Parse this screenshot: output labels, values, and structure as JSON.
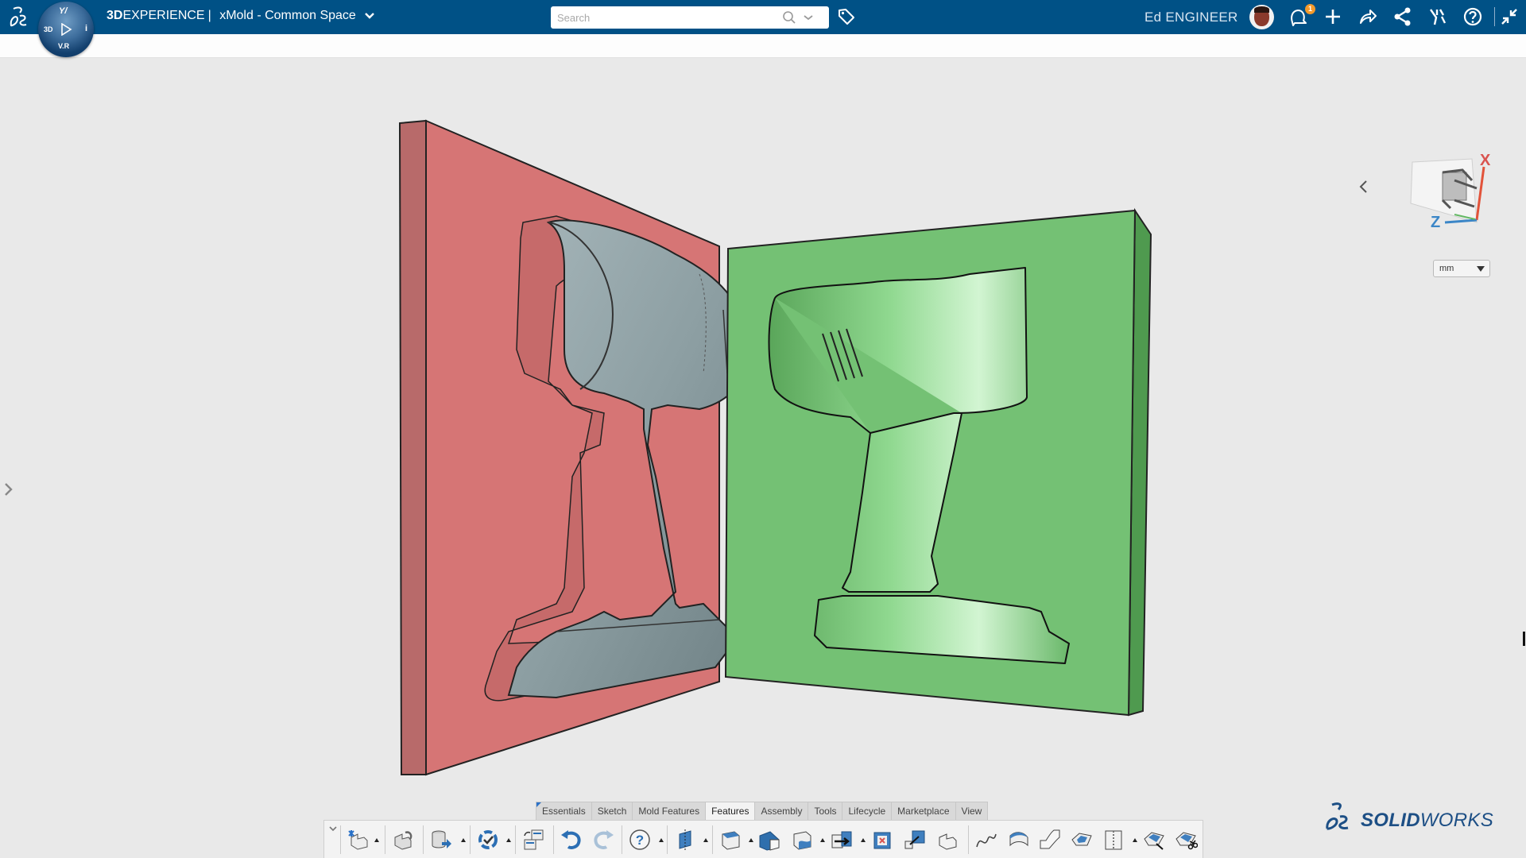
{
  "topbar": {
    "brand_bold": "3D",
    "brand_rest": "EXPERIENCE",
    "separator": "|",
    "app_name": "xMold - Common Space",
    "search_placeholder": "Search",
    "search_value": "",
    "user_name": "Ed ENGINEER",
    "notification_count": "1",
    "icons": [
      "ds-logo-icon",
      "compass-icon",
      "search-icon",
      "chevron-down-icon",
      "tag-icon",
      "notifications-icon",
      "add-icon",
      "share-icon",
      "social-share-icon",
      "apps-icon",
      "help-icon",
      "collapse-icon"
    ]
  },
  "compass": {
    "top": "Y/",
    "left": "3D",
    "right": "i",
    "bottom": "V.R"
  },
  "viewport": {
    "units": "mm",
    "axis_x": "X",
    "axis_z": "Z",
    "colors": {
      "core_half": "#d77676",
      "cavity_half": "#74c174",
      "part": "#8fa1a5",
      "background": "#e9e9e9"
    }
  },
  "command_manager": {
    "tabs": [
      {
        "label": "Essentials",
        "active": false
      },
      {
        "label": "Sketch",
        "active": false
      },
      {
        "label": "Mold Features",
        "active": false
      },
      {
        "label": "Features",
        "active": true
      },
      {
        "label": "Assembly",
        "active": false
      },
      {
        "label": "Tools",
        "active": false
      },
      {
        "label": "Lifecycle",
        "active": false
      },
      {
        "label": "Marketplace",
        "active": false
      },
      {
        "label": "View",
        "active": false
      }
    ],
    "tools": [
      "new-part",
      "rebuild",
      "save-to-platform",
      "lifecycle-update",
      "copy-with-references",
      "undo",
      "redo",
      "help",
      "reference-plane",
      "extruded-boss",
      "chamfer-cut",
      "cut-with-surface",
      "move-face",
      "delete-face",
      "scale",
      "thicken",
      "spline",
      "boundary-surface",
      "swept-surface",
      "filled-surface",
      "knit-surface",
      "offset-surface",
      "trim-surface"
    ]
  },
  "branding": {
    "sw_bold": "SOLID",
    "sw_rest": "WORKS"
  }
}
